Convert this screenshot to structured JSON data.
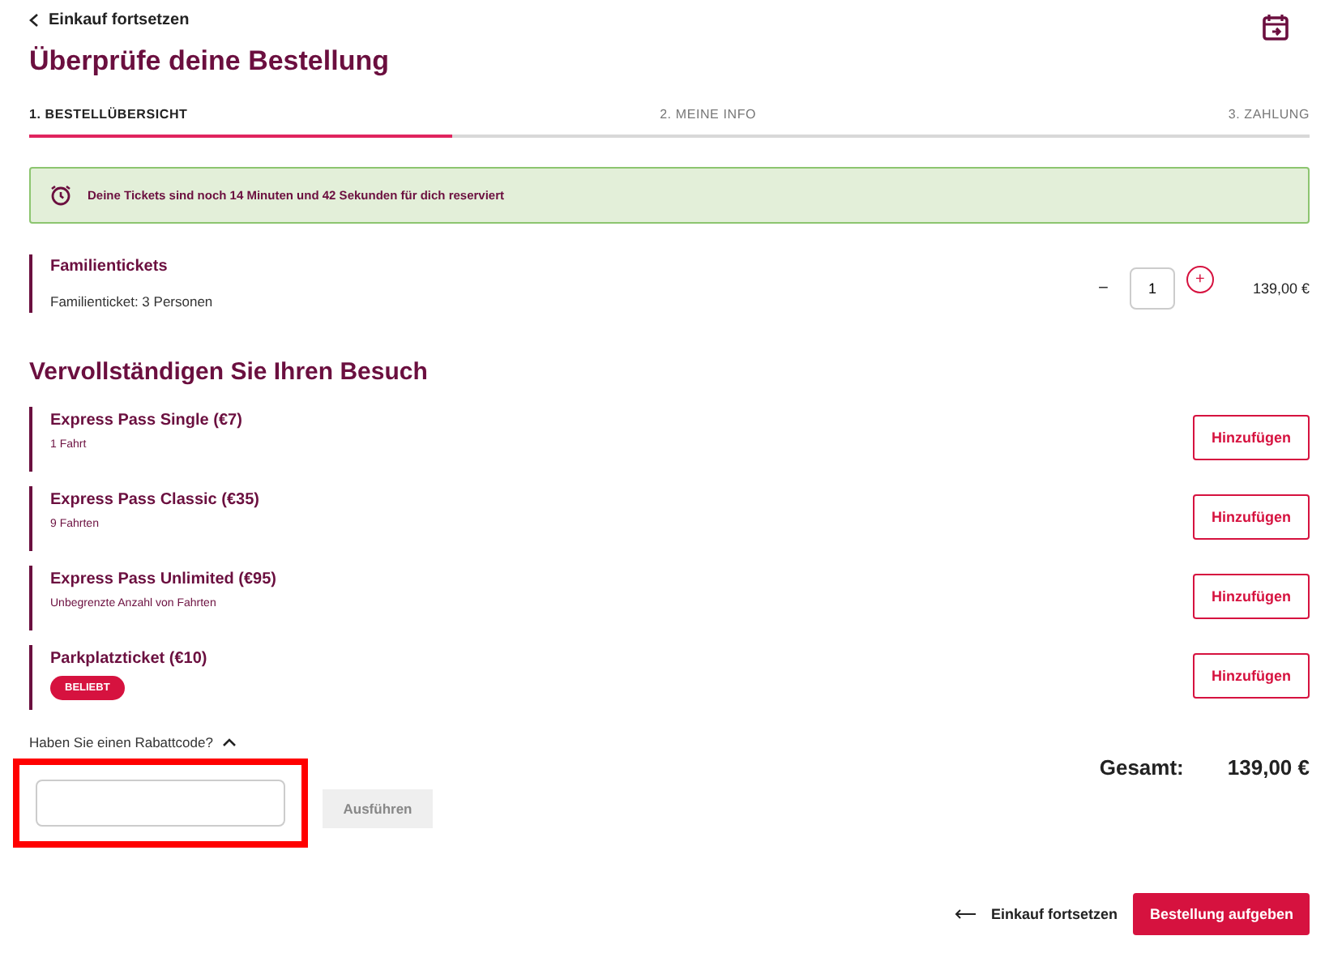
{
  "header": {
    "back_link": "Einkauf fortsetzen",
    "title": "Überprüfe deine Bestellung"
  },
  "steps": [
    {
      "label": "1. BESTELLÜBERSICHT",
      "selected": true
    },
    {
      "label": "2. MEINE INFO",
      "selected": false
    },
    {
      "label": "3. ZAHLUNG",
      "selected": false
    }
  ],
  "progress": {
    "level": 0.33
  },
  "timer_notice": "Deine Tickets sind noch 14 Minuten und 42 Sekunden für dich reserviert",
  "cart_item": {
    "title": "Familientickets",
    "description": "Familienticket: 3 Personen",
    "decrease": "−",
    "quantity": "1",
    "increase": "+",
    "price": "139,00 €"
  },
  "extras_title": "Vervollständigen Sie Ihren Besuch",
  "extras": [
    {
      "name": "Express Pass Single (€7)",
      "detail": "1 Fahrt",
      "button": "Hinzufügen"
    },
    {
      "name": "Express Pass Classic (€35)",
      "detail": "9 Fahrten",
      "button": "Hinzufügen"
    },
    {
      "name": "Express Pass Unlimited (€95)",
      "detail": "Unbegrenzte Anzahl von Fahrten",
      "button": "Hinzufügen"
    },
    {
      "name": "Parkplatzticket (€10)",
      "badge": "BELIEBT",
      "button": "Hinzufügen"
    }
  ],
  "discount": {
    "toggle": "Haben Sie einen Rabattcode?",
    "expanded": true,
    "highlighted": true,
    "apply_button": "Ausführen"
  },
  "total": {
    "label": "Gesamt:",
    "amount": "139,00 €"
  },
  "footer": {
    "back_link": "Einkauf fortsetzen",
    "submit": "Bestellung aufgeben"
  }
}
